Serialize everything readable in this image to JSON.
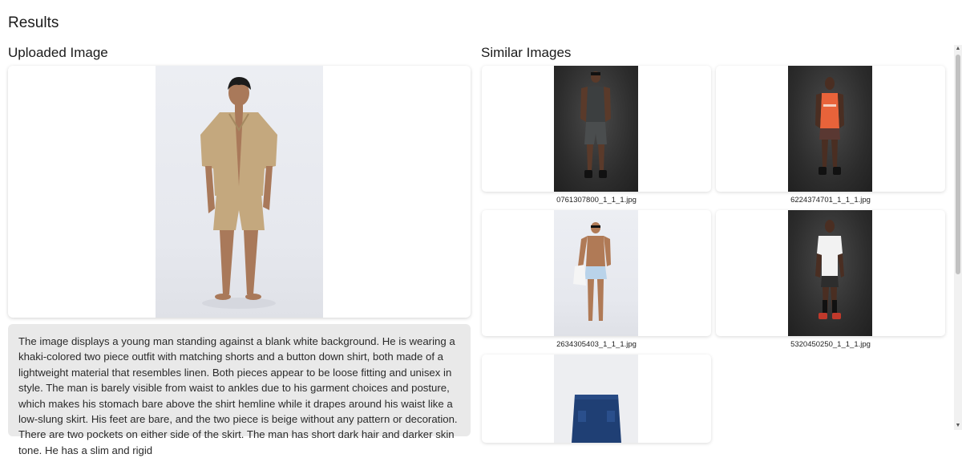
{
  "page": {
    "results_title": "Results",
    "uploaded_title": "Uploaded Image",
    "similar_title": "Similar Images"
  },
  "uploaded": {
    "description": "The image displays a young man standing against a blank white background. He is wearing a khaki-colored two piece outfit with matching shorts and a button down shirt, both made of a lightweight material that resembles linen. Both pieces appear to be loose fitting and unisex in style. The man is barely visible from waist to ankles due to his garment choices and posture, which makes his stomach bare above the shirt hemline while it drapes around his waist like a low-slung skirt. His feet are bare, and the two piece is beige without any pattern or decoration. There are two pockets on either side of the skirt. The man has short dark hair and darker skin tone. He has a slim and rigid"
  },
  "similar": {
    "items": [
      {
        "filename": "0761307800_1_1_1.jpg"
      },
      {
        "filename": "6224374701_1_1_1.jpg"
      },
      {
        "filename": "2634305403_1_1_1.jpg"
      },
      {
        "filename": "5320450250_1_1_1.jpg"
      },
      {
        "filename": ""
      }
    ]
  },
  "colors": {
    "khaki_outfit": "#c4a87e",
    "orange_tank": "#e8633a",
    "light_blue_shorts": "#b9d3ea",
    "denim_shorts": "#1f3f74"
  }
}
